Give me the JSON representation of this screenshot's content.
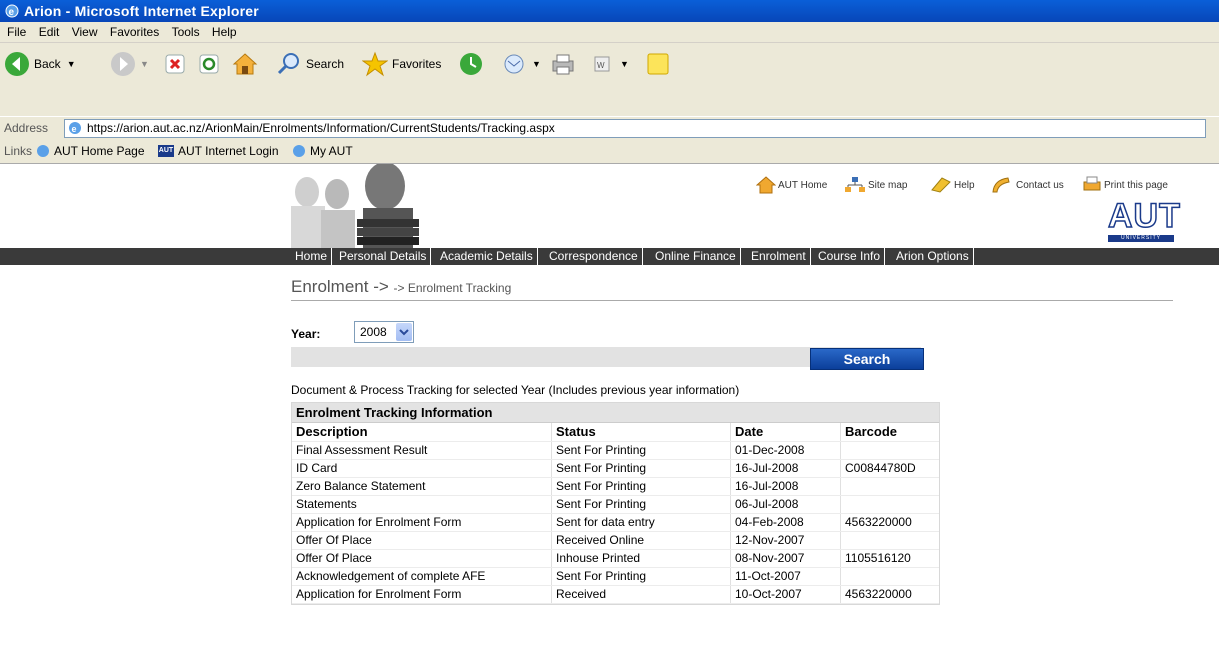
{
  "window": {
    "title": "Arion - Microsoft Internet Explorer"
  },
  "menu": [
    "File",
    "Edit",
    "View",
    "Favorites",
    "Tools",
    "Help"
  ],
  "toolbar": {
    "back_label": "Back",
    "search_label": "Search",
    "favorites_label": "Favorites"
  },
  "address": {
    "label": "Address",
    "url": "https://arion.aut.ac.nz/ArionMain/Enrolments/Information/CurrentStudents/Tracking.aspx"
  },
  "links": {
    "label": "Links",
    "items": [
      "AUT Home Page",
      "AUT Internet Login",
      "My AUT"
    ]
  },
  "site": {
    "top_links": [
      "AUT Home",
      "Site map",
      "Help",
      "Contact us",
      "Print this page"
    ],
    "logo_text": "AUT",
    "logo_sub": "UNIVERSITY",
    "nav": [
      "Home",
      "Personal Details",
      "Academic Details",
      "Correspondence",
      "Online Finance",
      "Enrolment",
      "Course Info",
      "Arion Options"
    ]
  },
  "main": {
    "heading": "Enrolment ->",
    "subheading": "-> Enrolment Tracking",
    "year_label": "Year:",
    "year_value": "2008",
    "search_button": "Search",
    "description": "Document & Process Tracking for selected Year (Includes previous year information)",
    "table": {
      "caption": "Enrolment Tracking Information",
      "headers": [
        "Description",
        "Status",
        "Date",
        "Barcode"
      ],
      "rows": [
        [
          "Final Assessment Result",
          "Sent For Printing",
          "01-Dec-2008",
          ""
        ],
        [
          "ID Card",
          "Sent For Printing",
          "16-Jul-2008",
          "C00844780D"
        ],
        [
          "Zero Balance Statement",
          "Sent For Printing",
          "16-Jul-2008",
          ""
        ],
        [
          "Statements",
          "Sent For Printing",
          "06-Jul-2008",
          ""
        ],
        [
          "Application for Enrolment Form",
          "Sent for data entry",
          "04-Feb-2008",
          "4563220000"
        ],
        [
          "Offer Of Place",
          "Received Online",
          "12-Nov-2007",
          ""
        ],
        [
          "Offer Of Place",
          "Inhouse Printed",
          "08-Nov-2007",
          "1105516120"
        ],
        [
          "Acknowledgement of complete AFE",
          "Sent For Printing",
          "11-Oct-2007",
          ""
        ],
        [
          "Application for Enrolment Form",
          "Received",
          "10-Oct-2007",
          "4563220000"
        ]
      ]
    }
  }
}
